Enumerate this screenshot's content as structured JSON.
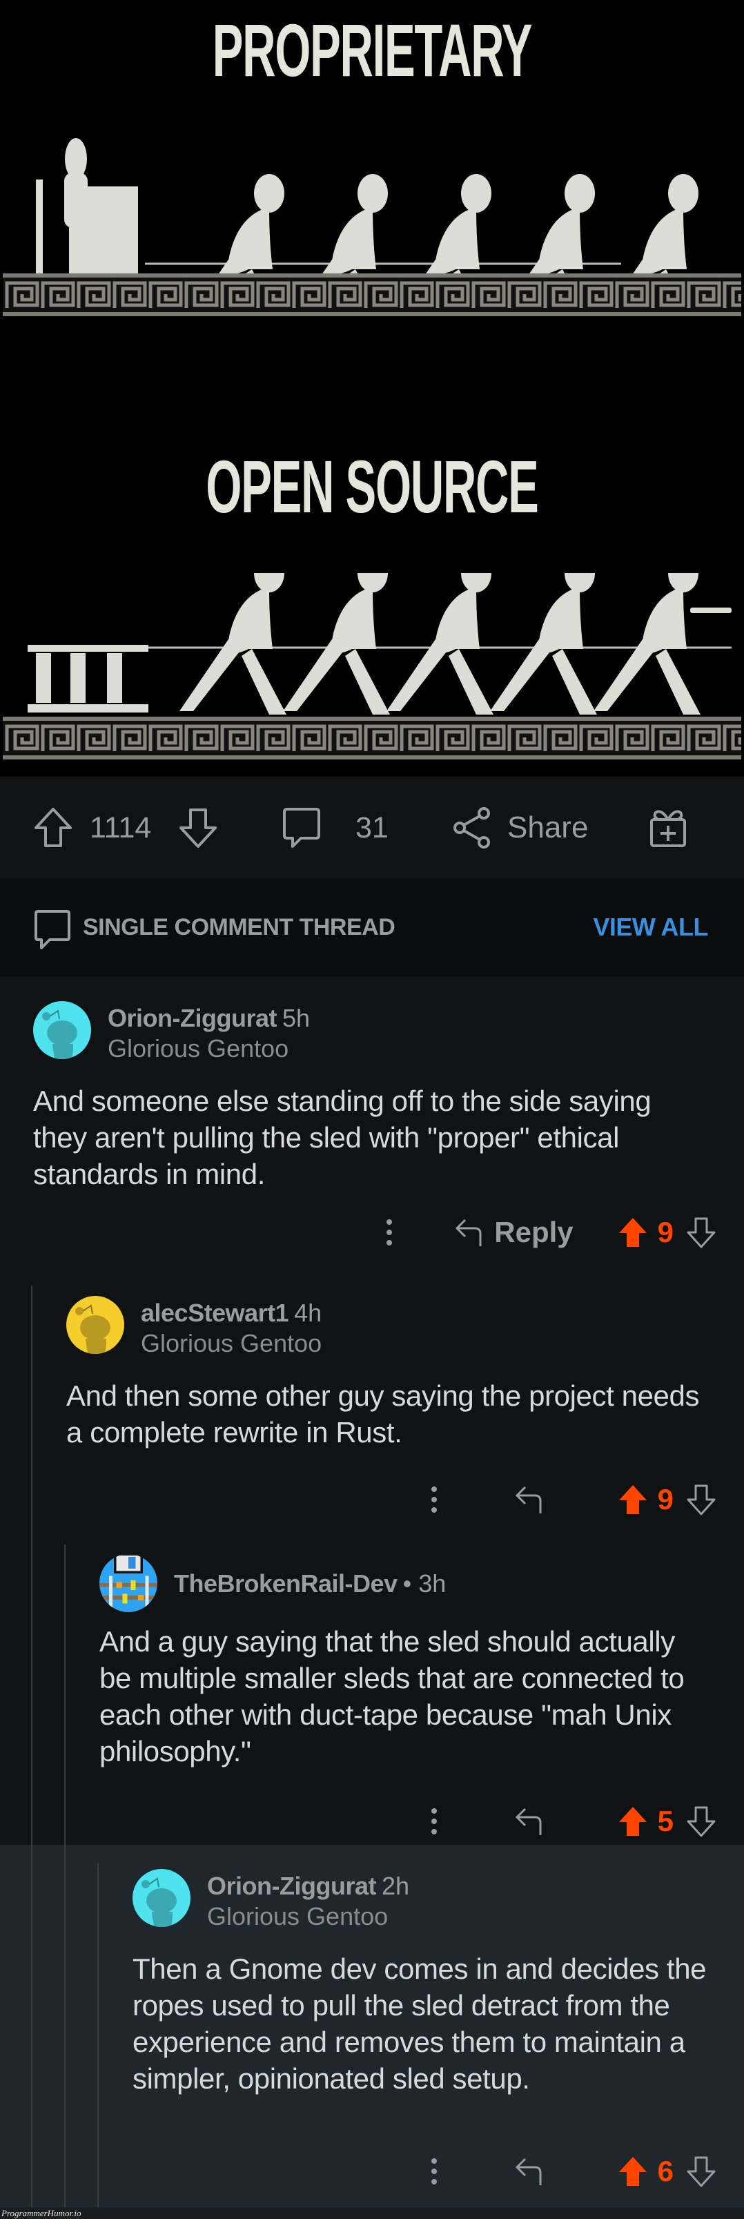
{
  "meme": {
    "top_caption": "PROPRIETARY",
    "bottom_caption": "OPEN SOURCE"
  },
  "post_actions": {
    "upvote_icon": "arrow-up-outline-icon",
    "score": "1114",
    "downvote_icon": "arrow-down-outline-icon",
    "comment_icon": "speech-bubble-icon",
    "comment_count": "31",
    "share_icon": "share-nodes-icon",
    "share_label": "Share",
    "award_icon": "gift-plus-icon"
  },
  "thread_header": {
    "icon": "speech-bubble-icon",
    "label": "SINGLE COMMENT THREAD",
    "view_all_label": "VIEW ALL",
    "accent": "#3a8fdf"
  },
  "colors": {
    "upvote_active": "#ff4500",
    "highlight_bg": "#1f262c"
  },
  "comments": [
    {
      "username": "Orion-Ziggurat",
      "time": "5h",
      "flair": "Glorious Gentoo",
      "avatar": "snoo-avatar-cyan",
      "body": "And someone else standing off to the side saying they aren't pulling the sled with \"proper\" ethical standards in mind.",
      "reply_label": "Reply",
      "score": "9",
      "upvoted": true
    },
    {
      "username": "alecStewart1",
      "time": "4h",
      "flair": "Glorious Gentoo",
      "avatar": "snoo-avatar-yellow",
      "body": "And then some other guy saying the project needs a complete rewrite in Rust.",
      "score": "9",
      "upvoted": true
    },
    {
      "username": "TheBrokenRail-Dev",
      "time": "• 3h",
      "avatar": "pixel-art-avatar",
      "body": "And a guy saying that the sled should actually be multiple smaller sleds that are connected to each other with duct-tape because \"mah Unix philosophy.\"",
      "score": "5",
      "upvoted": true
    },
    {
      "username": "Orion-Ziggurat",
      "time": "2h",
      "flair": "Glorious Gentoo",
      "avatar": "snoo-avatar-cyan",
      "body": "Then a Gnome dev comes in and decides the ropes used to pull the sled detract from the experience and removes them to maintain a simpler, opinionated sled setup.",
      "score": "6",
      "upvoted": true,
      "highlighted": true
    }
  ],
  "watermark": "ProgrammerHumor.io"
}
